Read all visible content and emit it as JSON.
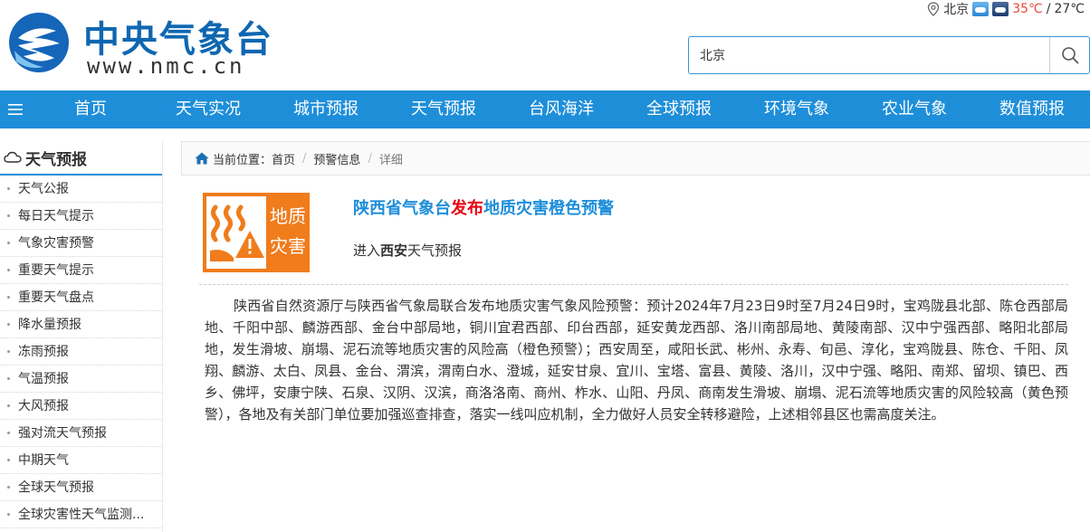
{
  "header": {
    "logo_cn": "中央气象台",
    "logo_url": "www.nmc.cn",
    "city": "北京",
    "temp_high": "35℃",
    "temp_sep": "/",
    "temp_low": "27℃",
    "search_value": "北京"
  },
  "nav": {
    "items": [
      "首页",
      "天气实况",
      "城市预报",
      "天气预报",
      "台风海洋",
      "全球预报",
      "环境气象",
      "农业气象",
      "数值预报"
    ]
  },
  "sidebar": {
    "title": "天气预报",
    "items": [
      "天气公报",
      "每日天气提示",
      "气象灾害预警",
      "重要天气提示",
      "重要天气盘点",
      "降水量预报",
      "冻雨预报",
      "气温预报",
      "大风预报",
      "强对流天气预报",
      "中期天气",
      "全球天气预报",
      "全球灾害性天气监测..."
    ]
  },
  "breadcrumb": {
    "label": "当前位置：",
    "home": "首页",
    "level2": "预警信息",
    "current": "详细"
  },
  "warning": {
    "icon_text_1": "地质",
    "icon_text_2": "灾害",
    "title_part1": "陕西省气象台",
    "title_part2": "发布",
    "title_part3": "地质灾害橙色预警",
    "enter_prefix": "进入",
    "enter_city": "西安",
    "enter_suffix": "天气预报",
    "body": "陕西省自然资源厅与陕西省气象局联合发布地质灾害气象风险预警：预计2024年7月23日9时至7月24日9时，宝鸡陇县北部、陈仓西部局地、千阳中部、麟游西部、金台中部局地，铜川宜君西部、印台西部，延安黄龙西部、洛川南部局地、黄陵南部、汉中宁强西部、略阳北部局地，发生滑坡、崩塌、泥石流等地质灾害的风险高（橙色预警）；西安周至，咸阳长武、彬州、永寿、旬邑、淳化，宝鸡陇县、陈仓、千阳、凤翔、麟游、太白、凤县、金台、渭滨，渭南白水、澄城，延安甘泉、宜川、宝塔、富县、黄陵、洛川，汉中宁强、略阳、南郑、留坝、镇巴、西乡、佛坪，安康宁陕、石泉、汉阴、汉滨，商洛洛南、商州、柞水、山阳、丹凤、商南发生滑坡、崩塌、泥石流等地质灾害的风险较高（黄色预警），各地及有关部门单位要加强巡查排查，落实一线叫应机制，全力做好人员安全转移避险，上述相邻县区也需高度关注。"
  },
  "colors": {
    "brand_blue": "#1e8ed9",
    "logo_blue": "#0f67b1",
    "warning_orange": "#f07c1c",
    "alert_red": "#e60012"
  }
}
